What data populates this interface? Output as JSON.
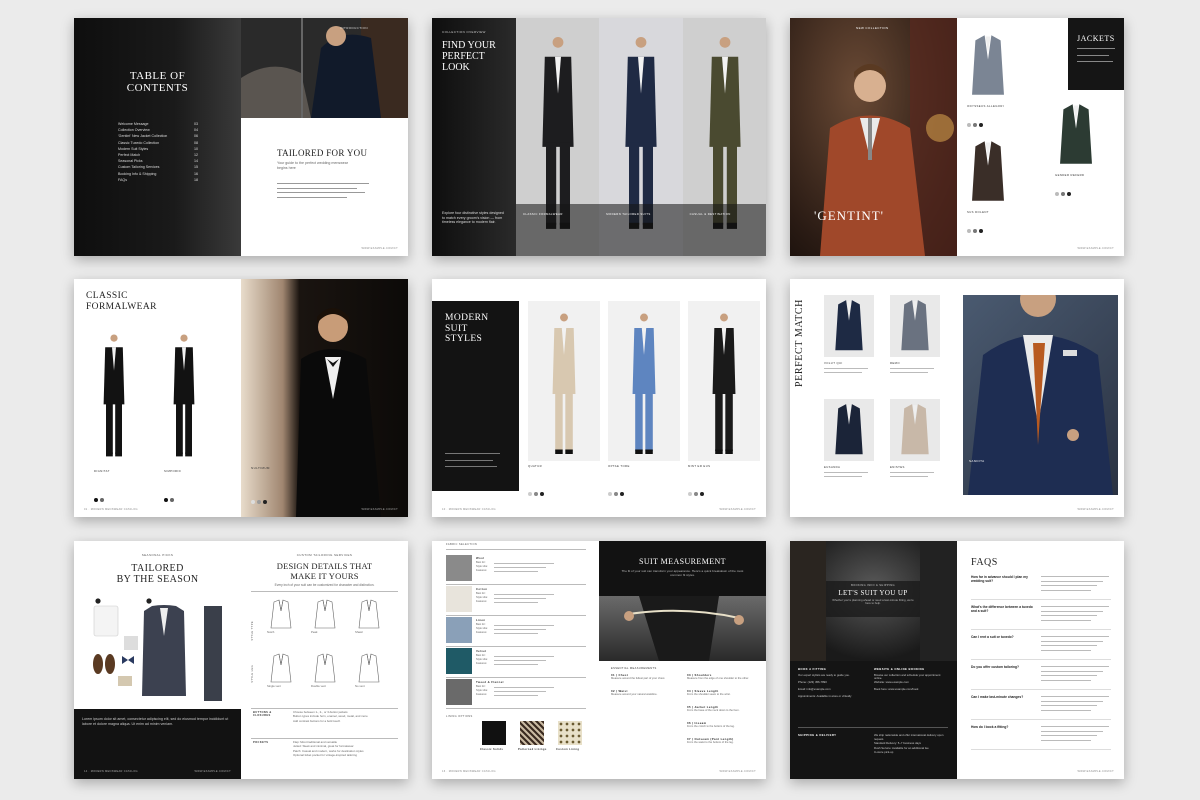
{
  "toc": {
    "intro_label": "INTRODUCTION",
    "title_line1": "TABLE OF",
    "title_line2": "CONTENTS",
    "items": [
      {
        "label": "Welcome Message",
        "page": "03"
      },
      {
        "label": "Collection Overview",
        "page": "04"
      },
      {
        "label": "'Gentint' New Jacket Collection",
        "page": "06"
      },
      {
        "label": "Classic Tuxedo Collection",
        "page": "08"
      },
      {
        "label": "Modern Suit Styles",
        "page": "10"
      },
      {
        "label": "Perfect Match",
        "page": "12"
      },
      {
        "label": "Seasonal Picks",
        "page": "14"
      },
      {
        "label": "Custom Tailoring Services",
        "page": "15"
      },
      {
        "label": "Booking Info & Shipping",
        "page": "16"
      },
      {
        "label": "FAQs",
        "page": "18"
      }
    ],
    "tailored_title": "TAILORED FOR YOU",
    "tailored_sub": "Your guide to the perfect wedding menswear begins here",
    "footer_url": "WWW.EXAMPLE.COM/CT"
  },
  "overview": {
    "label": "COLLECTION OVERVIEW",
    "title_line1": "FIND YOUR",
    "title_line2": "PERFECT",
    "title_line3": "LOOK",
    "desc": "Explore four distinctive styles designed to match every groom's vision — from timeless elegance to modern flair.",
    "panels": [
      "CLASSIC FORMALWEAR",
      "MODERN TAILORED SUITS",
      "CASUAL & DESTINATION"
    ],
    "colors": {
      "suit1": "#1d1d1f",
      "suit2": "#1f2a44",
      "suit3": "#4a4a30"
    }
  },
  "gentint": {
    "label": "NEW COLLECTION",
    "title": "'GENTINT'",
    "jackets_title": "JACKETS",
    "items": [
      {
        "name": "ODYSSEUS ALLEGORI",
        "color": "#7b8594"
      },
      {
        "name": "GENDER REFERD",
        "color": "#2c3b33"
      },
      {
        "name": "SUS DOLENT",
        "color": "#3a2e28"
      }
    ],
    "footer_url": "WWW.EXAMPLE.COM/CT"
  },
  "classic": {
    "title_line1": "CLASSIC",
    "title_line2": "FORMALWEAR",
    "models": [
      {
        "name": "DIGNITAT"
      },
      {
        "name": "SIMPORID"
      },
      {
        "name": "NULTIMUM"
      }
    ],
    "footer_left": "01 · MODERN MENSWEAR CATALOG",
    "footer_url": "WWW.EXAMPLE.COM/CT"
  },
  "modern": {
    "title_line1": "MODERN",
    "title_line2": "SUIT",
    "title_line3": "STYLES",
    "suits": [
      {
        "name": "QUATUR",
        "color": "#d8c8b0"
      },
      {
        "name": "OPTAE TORE",
        "color": "#5e85c0"
      },
      {
        "name": "MINT ER EUS",
        "color": "#1a1a1a"
      }
    ],
    "footer_left": "10 · MODERN MENSWEAR CATALOG",
    "footer_url": "WWW.EXAMPLE.COM/CT"
  },
  "perfect": {
    "title": "PERFECT MATCH",
    "items": [
      {
        "name": "VOLUT QUI",
        "color": "#1e2a44"
      },
      {
        "name": "REMO",
        "color": "#6a7280"
      },
      {
        "name": "EUSANDA",
        "color": "#1b2438"
      },
      {
        "name": "ENISTES",
        "color": "#c8b8a8"
      }
    ],
    "photo_label": "SANDITA",
    "footer_url": "WWW.EXAMPLE.COM/CT"
  },
  "seasonal": {
    "label": "SEASONAL PICKS",
    "title_line1": "TAILORED",
    "title_line2": "BY THE SEASON",
    "body": "Lorem ipsum dolor sit amet, consectetur adipiscing elit, sed do eiusmod tempor incididunt ut labore et dolore magna aliqua. Ut enim ad minim veniam.",
    "footer_left": "14 · MODERN MENSWEAR CATALOG",
    "footer_url": "WWW.EXAMPLE.COM/CT",
    "custom_label": "CUSTOM TAILORING SERVICES",
    "custom_title_line1": "DESIGN DETAILS THAT",
    "custom_title_line2": "MAKE IT YOURS",
    "custom_sub": "Every inch of your suit can be customized for character and distinction.",
    "jacket_labels": [
      "Notch",
      "Peak",
      "Shawl"
    ],
    "row_labels": [
      "STYLE TYPE",
      "STYLE LEG"
    ],
    "lower_labels": [
      "Single vent",
      "Double vent",
      "No vent"
    ],
    "sections": [
      {
        "label": "BUTTONS & CLOSURES",
        "lines": [
          "Choose between 1-, 2-, or 3-button jackets",
          "Button types include horn, enamel, wood, metal, and more",
          "Add contrast buttons for a bold touch"
        ]
      },
      {
        "label": "POCKETS",
        "lines": [
          "Flap: Most traditional and versatile",
          "Jetted: Sleek and minimal, great for formalwear",
          "Patch: Casual and modern, works for destination styles",
          "Optional ticket pocket for vintage-inspired tailoring"
        ]
      }
    ]
  },
  "fabric": {
    "label": "FABRIC SELECTION",
    "rows": [
      {
        "name": "Wool",
        "color": "#8a8a8a"
      },
      {
        "name": "Cotton",
        "color": "#e8e4dc"
      },
      {
        "name": "Linen",
        "color": "#8aa0b8"
      },
      {
        "name": "Velvet",
        "color": "#1f5a66"
      },
      {
        "name": "Tweed & Flannel",
        "color": "#6a6a6a"
      }
    ],
    "row_lines": [
      "Best for:",
      "Style vibe:",
      "Features:"
    ],
    "lining_label": "LINING OPTIONS",
    "linings": [
      "Classic Solids",
      "Patterned Linings",
      "Custom Lining"
    ],
    "measure_title": "SUIT MEASUREMENT",
    "measure_sub": "The fit of your suit can transform your appearance. Here's a quick breakdown of the most common fit styles.",
    "essential_label": "ESSENTIAL MEASUREMENTS",
    "points": [
      {
        "label": "01 | Chest",
        "text": "Measure around the fullest part of your chest."
      },
      {
        "label": "02 | Waist",
        "text": "Measure around your natural waistline."
      },
      {
        "label": "03 | Shoulders",
        "text": "Measure from the edge of one shoulder to the other."
      },
      {
        "label": "04 | Sleeve Length",
        "text": "From the shoulder seam to the wrist."
      },
      {
        "label": "05 | Jacket Length",
        "text": "From the base of the neck down to the hem."
      },
      {
        "label": "06 | Inseam",
        "text": "From the crotch to the bottom of the leg."
      },
      {
        "label": "07 | Outseam (Pant Length)",
        "text": "From the waist to the bottom of the leg."
      }
    ],
    "footer_left": "16 · MODERN MENSWEAR CATALOG",
    "footer_url": "WWW.EXAMPLE.COM/CT"
  },
  "booking": {
    "label": "BOOKING INFO & SHIPPING",
    "title": "LET'S SUIT YOU UP",
    "sub": "Whether you're planning ahead or need a last-minute fitting, we're here to help.",
    "cols": [
      {
        "title": "BOOK A FITTING",
        "lines": [
          "Our expert stylists are ready to guide you.",
          "Phone: (123) 456-7890",
          "Email: info@example.com",
          "Appointments: Available in-store or virtually"
        ]
      },
      {
        "title": "WEBSITE & ONLINE BOOKING",
        "lines": [
          "Browse our collection and schedule your appointment online.",
          "Website: www.example.com",
          "Book here: www.example.com/book"
        ]
      }
    ],
    "ship_title": "SHIPPING & DELIVERY",
    "ship_lines": [
      "We ship nationwide and offer international delivery upon request.",
      "Standard Delivery: 5–7 business days",
      "Rush Service: Available for an additional fee",
      "In-store pick-up"
    ],
    "faq_title": "FAQS",
    "faqs": [
      "How far in advance should I plan my wedding suit?",
      "What's the difference between a tuxedo and a suit?",
      "Can I rent a suit or tuxedo?",
      "Do you offer custom tailoring?",
      "Can I make last-minute changes?",
      "How do I book a fitting?"
    ],
    "footer_url": "WWW.EXAMPLE.COM/CT"
  }
}
